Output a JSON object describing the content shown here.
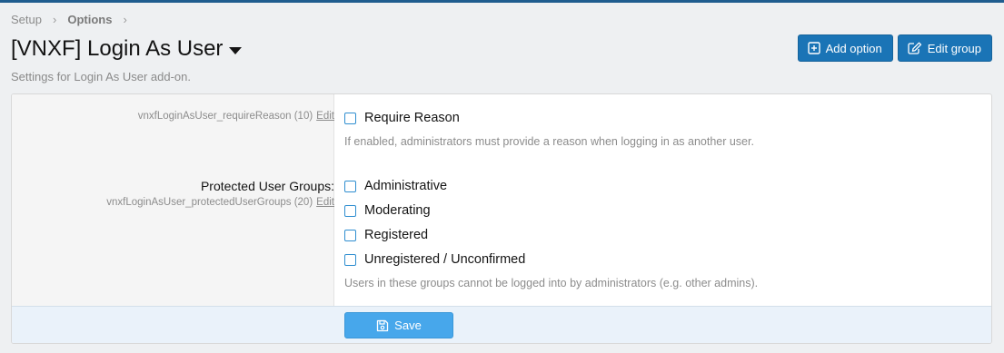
{
  "breadcrumb": {
    "items": [
      "Setup",
      "Options"
    ]
  },
  "page": {
    "title": "[VNXF] Login As User",
    "description": "Settings for Login As User add-on."
  },
  "actions": {
    "add_option": "Add option",
    "edit_group": "Edit group"
  },
  "options": {
    "require_reason": {
      "hint": "vnxfLoginAsUser_requireReason (10)",
      "edit": "Edit",
      "checkbox_label": "Require Reason",
      "explain": "If enabled, administrators must provide a reason when logging in as another user."
    },
    "protected_groups": {
      "label": "Protected User Groups:",
      "hint": "vnxfLoginAsUser_protectedUserGroups (20)",
      "edit": "Edit",
      "groups": [
        "Administrative",
        "Moderating",
        "Registered",
        "Unregistered / Unconfirmed"
      ],
      "explain": "Users in these groups cannot be logged into by administrators (e.g. other admins)."
    }
  },
  "submit": {
    "save": "Save"
  },
  "colors": {
    "accent": "#1a74b6",
    "save": "#47a7eb",
    "checkbox_border": "#2f8ed0"
  },
  "icons": {
    "add": "plus-square-icon",
    "edit": "edit-pencil-icon",
    "save": "floppy-disk-icon",
    "title_menu": "caret-down-icon"
  }
}
